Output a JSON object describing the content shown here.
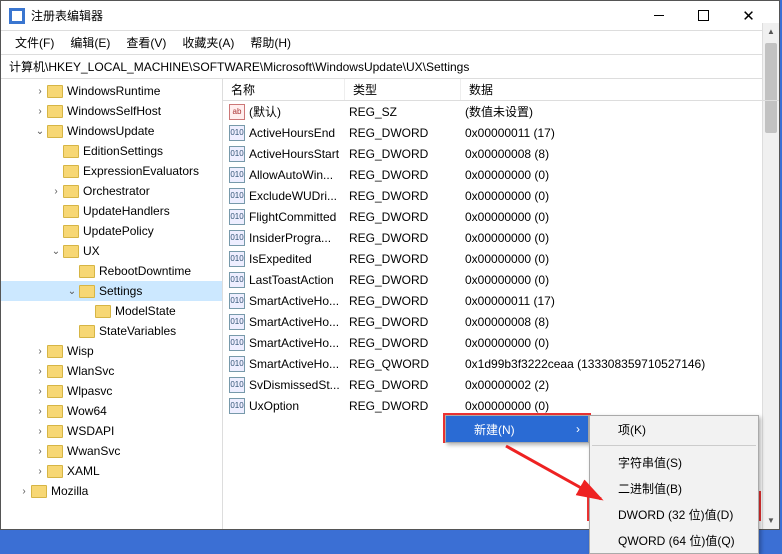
{
  "window": {
    "title": "注册表编辑器"
  },
  "menu": {
    "file": "文件(F)",
    "edit": "编辑(E)",
    "view": "查看(V)",
    "favorites": "收藏夹(A)",
    "help": "帮助(H)"
  },
  "path": "计算机\\HKEY_LOCAL_MACHINE\\SOFTWARE\\Microsoft\\WindowsUpdate\\UX\\Settings",
  "columns": {
    "name": "名称",
    "type": "类型",
    "data": "数据"
  },
  "tree": [
    {
      "indent": 2,
      "chev": "›",
      "label": "WindowsRuntime"
    },
    {
      "indent": 2,
      "chev": "›",
      "label": "WindowsSelfHost"
    },
    {
      "indent": 2,
      "chev": "⌄",
      "label": "WindowsUpdate"
    },
    {
      "indent": 3,
      "chev": "",
      "label": "EditionSettings"
    },
    {
      "indent": 3,
      "chev": "",
      "label": "ExpressionEvaluators"
    },
    {
      "indent": 3,
      "chev": "›",
      "label": "Orchestrator"
    },
    {
      "indent": 3,
      "chev": "",
      "label": "UpdateHandlers"
    },
    {
      "indent": 3,
      "chev": "",
      "label": "UpdatePolicy"
    },
    {
      "indent": 3,
      "chev": "⌄",
      "label": "UX"
    },
    {
      "indent": 4,
      "chev": "",
      "label": "RebootDowntime"
    },
    {
      "indent": 4,
      "chev": "⌄",
      "label": "Settings",
      "selected": true
    },
    {
      "indent": 5,
      "chev": "",
      "label": "ModelState"
    },
    {
      "indent": 4,
      "chev": "",
      "label": "StateVariables"
    },
    {
      "indent": 2,
      "chev": "›",
      "label": "Wisp"
    },
    {
      "indent": 2,
      "chev": "›",
      "label": "WlanSvc"
    },
    {
      "indent": 2,
      "chev": "›",
      "label": "Wlpasvc"
    },
    {
      "indent": 2,
      "chev": "›",
      "label": "Wow64"
    },
    {
      "indent": 2,
      "chev": "›",
      "label": "WSDAPI"
    },
    {
      "indent": 2,
      "chev": "›",
      "label": "WwanSvc"
    },
    {
      "indent": 2,
      "chev": "›",
      "label": "XAML"
    },
    {
      "indent": 1,
      "chev": "›",
      "label": "Mozilla"
    }
  ],
  "values": [
    {
      "icon": "str",
      "name": "(默认)",
      "type": "REG_SZ",
      "data": "(数值未设置)"
    },
    {
      "icon": "num",
      "name": "ActiveHoursEnd",
      "type": "REG_DWORD",
      "data": "0x00000011 (17)"
    },
    {
      "icon": "num",
      "name": "ActiveHoursStart",
      "type": "REG_DWORD",
      "data": "0x00000008 (8)"
    },
    {
      "icon": "num",
      "name": "AllowAutoWin...",
      "type": "REG_DWORD",
      "data": "0x00000000 (0)"
    },
    {
      "icon": "num",
      "name": "ExcludeWUDri...",
      "type": "REG_DWORD",
      "data": "0x00000000 (0)"
    },
    {
      "icon": "num",
      "name": "FlightCommitted",
      "type": "REG_DWORD",
      "data": "0x00000000 (0)"
    },
    {
      "icon": "num",
      "name": "InsiderProgra...",
      "type": "REG_DWORD",
      "data": "0x00000000 (0)"
    },
    {
      "icon": "num",
      "name": "IsExpedited",
      "type": "REG_DWORD",
      "data": "0x00000000 (0)"
    },
    {
      "icon": "num",
      "name": "LastToastAction",
      "type": "REG_DWORD",
      "data": "0x00000000 (0)"
    },
    {
      "icon": "num",
      "name": "SmartActiveHo...",
      "type": "REG_DWORD",
      "data": "0x00000011 (17)"
    },
    {
      "icon": "num",
      "name": "SmartActiveHo...",
      "type": "REG_DWORD",
      "data": "0x00000008 (8)"
    },
    {
      "icon": "num",
      "name": "SmartActiveHo...",
      "type": "REG_DWORD",
      "data": "0x00000000 (0)"
    },
    {
      "icon": "num",
      "name": "SmartActiveHo...",
      "type": "REG_QWORD",
      "data": "0x1d99b3f3222ceaa (133308359710527146)"
    },
    {
      "icon": "num",
      "name": "SvDismissedSt...",
      "type": "REG_DWORD",
      "data": "0x00000002 (2)"
    },
    {
      "icon": "num",
      "name": "UxOption",
      "type": "REG_DWORD",
      "data": "0x00000000 (0)"
    }
  ],
  "context_menu1": {
    "new": "新建(N)",
    "arrow": "›"
  },
  "context_menu2": {
    "key": "项(K)",
    "string": "字符串值(S)",
    "binary": "二进制值(B)",
    "dword": "DWORD (32 位)值(D)",
    "qword": "QWORD (64 位)值(Q)"
  }
}
